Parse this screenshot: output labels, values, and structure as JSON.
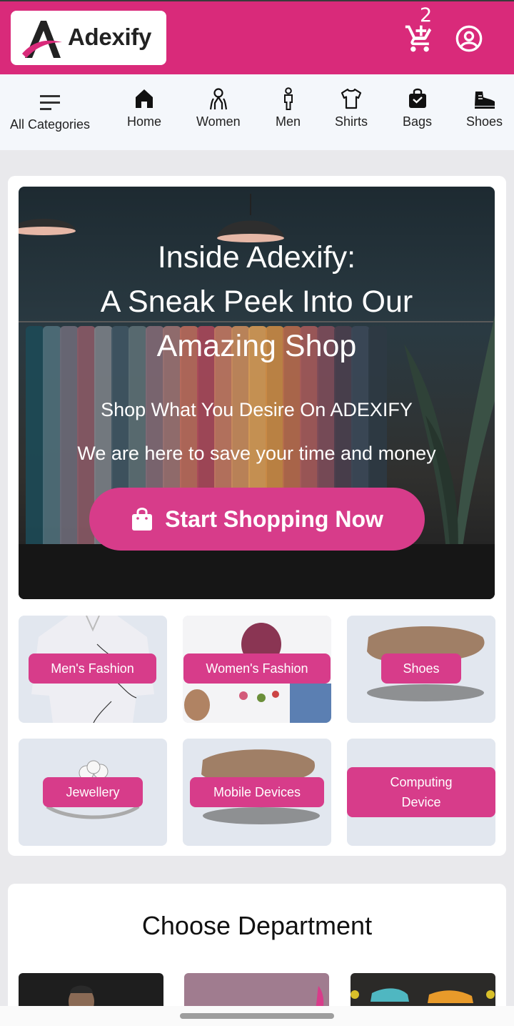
{
  "header": {
    "logo_text": "Adexify",
    "cart_count": "2",
    "brand_color": "#d92a7a",
    "icons": [
      "cart-icon",
      "user-icon"
    ]
  },
  "categories": [
    {
      "label": "All Categories",
      "icon": "menu-icon"
    },
    {
      "label": "Home",
      "icon": "home-icon"
    },
    {
      "label": "Women",
      "icon": "woman-icon"
    },
    {
      "label": "Men",
      "icon": "man-icon"
    },
    {
      "label": "Shirts",
      "icon": "shirt-icon"
    },
    {
      "label": "Bags",
      "icon": "bag-icon"
    },
    {
      "label": "Shoes",
      "icon": "shoe-icon"
    }
  ],
  "hero": {
    "title_line1": "Inside Adexify:",
    "title_line2": "A Sneak Peek Into Our",
    "title_line3": "Amazing Shop",
    "subtitle1": "Shop What You Desire On ADEXIFY",
    "subtitle2": "We are here to save your time and money",
    "cta_label": "Start Shopping Now",
    "cta_color": "#d73c8a"
  },
  "tiles": [
    {
      "label": "Men's Fashion"
    },
    {
      "label": "Women's Fashion"
    },
    {
      "label": "Shoes"
    },
    {
      "label": "Jewellery"
    },
    {
      "label": "Mobile Devices"
    },
    {
      "label": "Computing Device"
    }
  ],
  "department": {
    "title": "Choose Department"
  }
}
